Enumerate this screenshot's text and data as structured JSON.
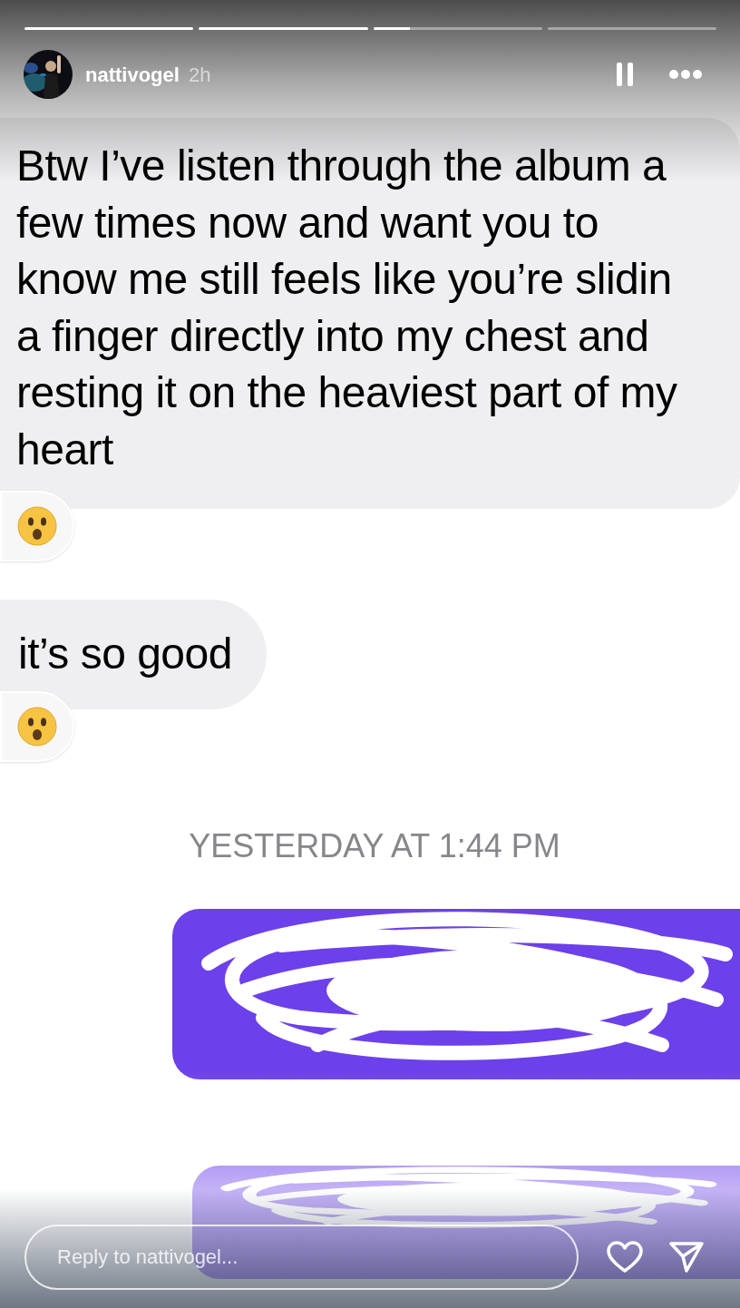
{
  "progress": [
    {
      "level": 1
    },
    {
      "level": 1
    },
    {
      "level": 0.22
    },
    {
      "level": 0
    }
  ],
  "header": {
    "username": "nattivogel",
    "age": "2h"
  },
  "messages": [
    {
      "kind": "incoming",
      "text": "Btw I’ve listen through the album a\nfew times now and want you to\nknow me still feels like you’re slidin\na finger directly into my chest and\nresting it on the heaviest part of my\nheart",
      "reaction": true
    },
    {
      "kind": "incoming",
      "text": "it’s so good",
      "reaction": true
    }
  ],
  "timestamp": "YESTERDAY AT 1:44 PM",
  "outgoing_messages": [
    {
      "kind": "redacted"
    },
    {
      "kind": "redacted"
    }
  ],
  "reply": {
    "placeholder": "Reply to nattivogel..."
  }
}
